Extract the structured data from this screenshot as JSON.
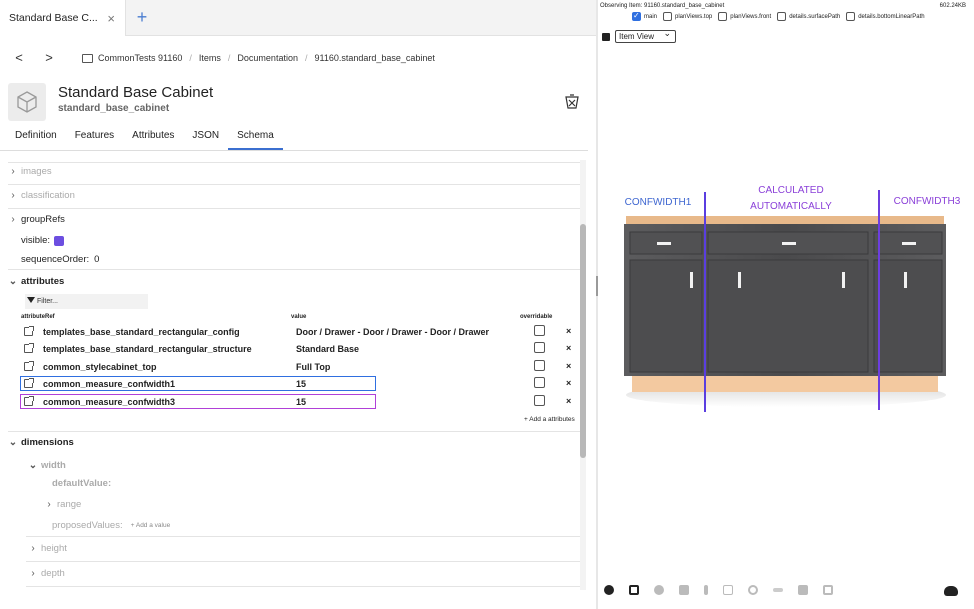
{
  "tab": {
    "title": "Standard Base C...",
    "close": "×",
    "new": "+"
  },
  "breadcrumb": {
    "back": "<",
    "forward": ">",
    "items": [
      "CommonTests 91160",
      "Items",
      "Documentation",
      "91160.standard_base_cabinet"
    ],
    "sep": "/"
  },
  "header": {
    "title": "Standard Base Cabinet",
    "subtitle": "standard_base_cabinet"
  },
  "tabs": [
    "Definition",
    "Features",
    "Attributes",
    "JSON",
    "Schema"
  ],
  "active_tab": "Schema",
  "schema": {
    "images": "images",
    "classification": "classification",
    "groupRefs": "groupRefs",
    "visible_label": "visible:",
    "visible_color": "#6c4ee0",
    "sequence_label": "sequenceOrder:",
    "sequence_value": "0",
    "attributes_label": "attributes",
    "filter_placeholder": "Filter...",
    "columns": {
      "ref": "attributeRef",
      "value": "value",
      "overridable": "overridable"
    },
    "rows": [
      {
        "name": "templates_base_standard_rectangular_config",
        "value": "Door / Drawer - Door / Drawer - Door / Drawer"
      },
      {
        "name": "templates_base_standard_rectangular_structure",
        "value": "Standard Base"
      },
      {
        "name": "common_stylecabinet_top",
        "value": "Full Top"
      },
      {
        "name": "common_measure_confwidth1",
        "value": "15"
      },
      {
        "name": "common_measure_confwidth3",
        "value": "15"
      }
    ],
    "remove": "×",
    "add_attributes": "+ Add a attributes",
    "dimensions_label": "dimensions",
    "width_label": "width",
    "default_value_label": "defaultValue:",
    "range_label": "range",
    "proposed_label": "proposedValues:",
    "add_value": "+ Add a value",
    "height_label": "height",
    "depth_label": "depth"
  },
  "viewer": {
    "observing": "Observing Item: 91160.standard_base_cabinet",
    "size": "602.24KB",
    "checks": [
      "main",
      "planViews.top",
      "planViews.front",
      "details.surfacePath",
      "details.bottomLinearPath"
    ],
    "view_mode": "Item View",
    "labels": {
      "left": "CONFWIDTH1",
      "middle1": "CALCULATED",
      "middle2": "AUTOMATICALLY",
      "right": "CONFWIDTH3"
    },
    "colors": {
      "blue": "#3e66d0",
      "purple": "#8a3fd8"
    }
  }
}
